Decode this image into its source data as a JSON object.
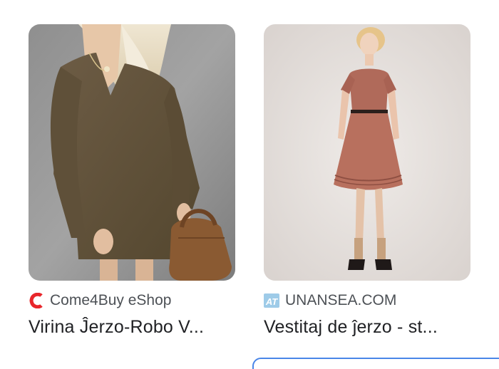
{
  "results": [
    {
      "source_name": "Come4Buy eShop",
      "favicon_icon": "come4buy-c-logo-icon",
      "favicon_color": "#e8262b",
      "title": "Virina Ĵerzo-Robo V...",
      "image_subject": "woman in brown knit long-sleeve V-neck dress holding a brown handbag"
    },
    {
      "source_name": "UNANSEA.COM",
      "favicon_icon": "unansea-logo-icon",
      "favicon_color": "#9ecbe8",
      "title": "Vestitaj de ĵerzo - st...",
      "image_subject": "woman in rust-pink short-sleeve knee-length dress with belt"
    }
  ]
}
